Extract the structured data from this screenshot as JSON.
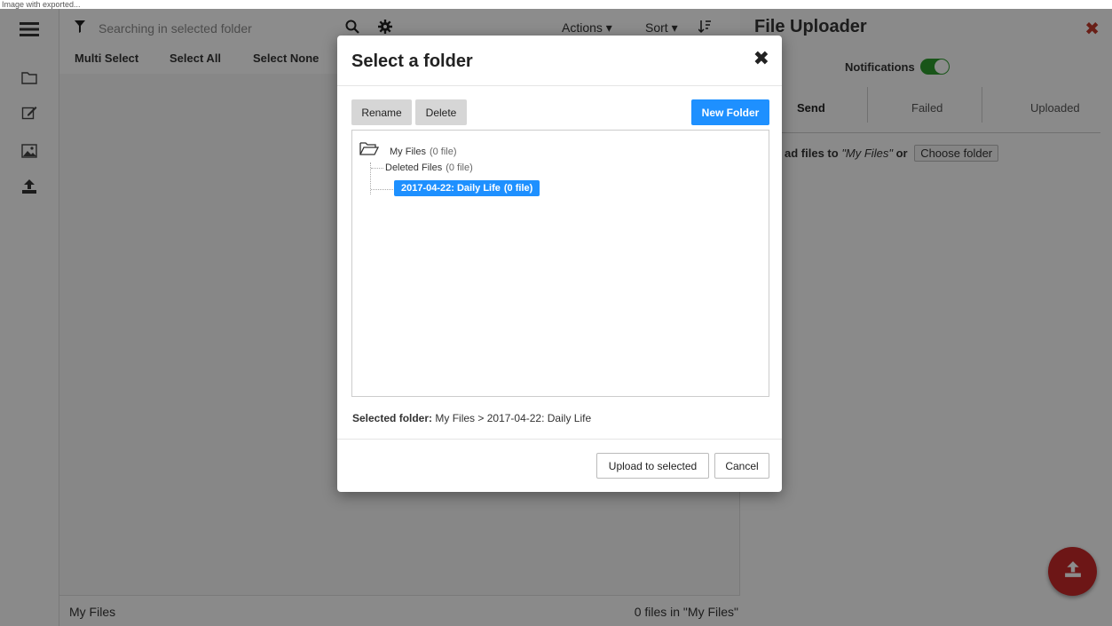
{
  "topstrip": {
    "text": "Image with exported..."
  },
  "rail": {
    "items": [
      "menu-icon",
      "folder-icon",
      "edit-icon",
      "image-icon",
      "upload-icon"
    ]
  },
  "toolbar": {
    "search_placeholder": "Searching in selected folder",
    "actions_label": "Actions",
    "sort_label": "Sort"
  },
  "subbar": {
    "multi_select": "Multi Select",
    "select_all": "Select All",
    "select_none": "Select None"
  },
  "footer": {
    "folder": "My Files",
    "count": "0 files in \"My Files\""
  },
  "uploader": {
    "title": "File Uploader",
    "notifications_label": "Notifications",
    "notifications_on": true,
    "tabs": [
      "Send",
      "Failed",
      "Uploaded"
    ],
    "upload_prefix": "ad files to",
    "upload_target": "\"My Files\"",
    "upload_or": "or",
    "choose_folder": "Choose folder"
  },
  "modal": {
    "title": "Select a folder",
    "rename": "Rename",
    "delete": "Delete",
    "new_folder": "New Folder",
    "tree": {
      "root": {
        "label": "My Files",
        "count": "(0 file)"
      },
      "children": [
        {
          "label": "Deleted Files",
          "count": "(0 file)",
          "selected": false
        },
        {
          "label": "2017-04-22: Daily Life",
          "count": "(0 file)",
          "selected": true
        }
      ]
    },
    "selected_label": "Selected folder:",
    "selected_path": "My Files > 2017-04-22: Daily Life",
    "upload_to_selected": "Upload to selected",
    "cancel": "Cancel"
  },
  "colors": {
    "accent_blue": "#1e90ff",
    "danger_red": "#c62828",
    "toggle_green": "#2e9b2e"
  }
}
